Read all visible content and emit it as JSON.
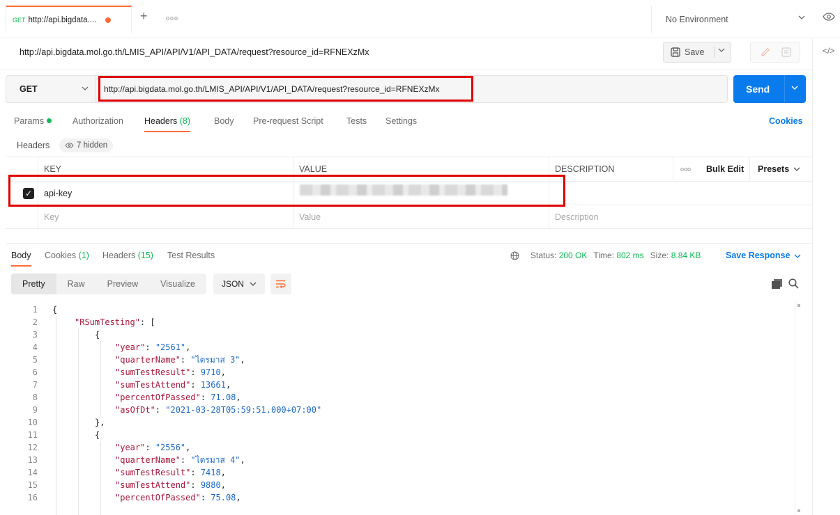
{
  "tab": {
    "method": "GET",
    "label": "http://api.bigdata...."
  },
  "environment": {
    "label": "No Environment"
  },
  "request": {
    "title_url": "http://api.bigdata.mol.go.th/LMIS_API/API/V1/API_DATA/request?resource_id=RFNEXzMx",
    "method": "GET",
    "url": "http://api.bigdata.mol.go.th/LMIS_API/API/V1/API_DATA/request?resource_id=RFNEXzMx",
    "save_label": "Save",
    "send_label": "Send"
  },
  "request_tabs": {
    "params": "Params",
    "authorization": "Authorization",
    "headers": "Headers",
    "headers_count": "(8)",
    "body": "Body",
    "prerequest": "Pre-request Script",
    "tests": "Tests",
    "settings": "Settings",
    "cookies": "Cookies"
  },
  "headers_section": {
    "label": "Headers",
    "hidden": "7 hidden"
  },
  "headers_table": {
    "col_key": "KEY",
    "col_value": "VALUE",
    "col_description": "DESCRIPTION",
    "more": "ooo",
    "bulk_edit": "Bulk Edit",
    "presets": "Presets",
    "row_key": "api-key",
    "ph_key": "Key",
    "ph_value": "Value",
    "ph_description": "Description"
  },
  "response_tabs": {
    "body": "Body",
    "cookies": "Cookies",
    "cookies_count": "(1)",
    "headers": "Headers",
    "headers_count": "(15)",
    "test_results": "Test Results"
  },
  "status": {
    "status_label": "Status:",
    "status_value": "200 OK",
    "time_label": "Time:",
    "time_value": "802 ms",
    "size_label": "Size:",
    "size_value": "8.84 KB",
    "save_response": "Save Response"
  },
  "view_modes": {
    "pretty": "Pretty",
    "raw": "Raw",
    "preview": "Preview",
    "visualize": "Visualize",
    "format": "JSON"
  },
  "code": {
    "l1": "{",
    "l2_key": "\"RSumTesting\"",
    "l2_rest": ": [",
    "l3": "{",
    "l4_key": "\"year\"",
    "l4_val": "\"2561\"",
    "l5_key": "\"quarterName\"",
    "l5_val": "\"ไตรมาส 3\"",
    "l6_key": "\"sumTestResult\"",
    "l6_val": "9710",
    "l7_key": "\"sumTestAttend\"",
    "l7_val": "13661",
    "l8_key": "\"percentOfPassed\"",
    "l8_val": "71.08",
    "l9_key": "\"asOfDt\"",
    "l9_val": "\"2021-03-28T05:59:51.000+07:00\"",
    "l10": "},",
    "l11": "{",
    "l12_key": "\"year\"",
    "l12_val": "\"2556\"",
    "l13_key": "\"quarterName\"",
    "l13_val": "\"ไตรมาส 4\"",
    "l14_key": "\"sumTestResult\"",
    "l14_val": "7418",
    "l15_key": "\"sumTestAttend\"",
    "l15_val": "9880",
    "l16_key": "\"percentOfPassed\"",
    "l16_val": "75.08"
  },
  "colors": {
    "accent": "#ff6c37",
    "primary": "#097bed",
    "success": "#0cbb52",
    "highlight": "#e00000"
  }
}
